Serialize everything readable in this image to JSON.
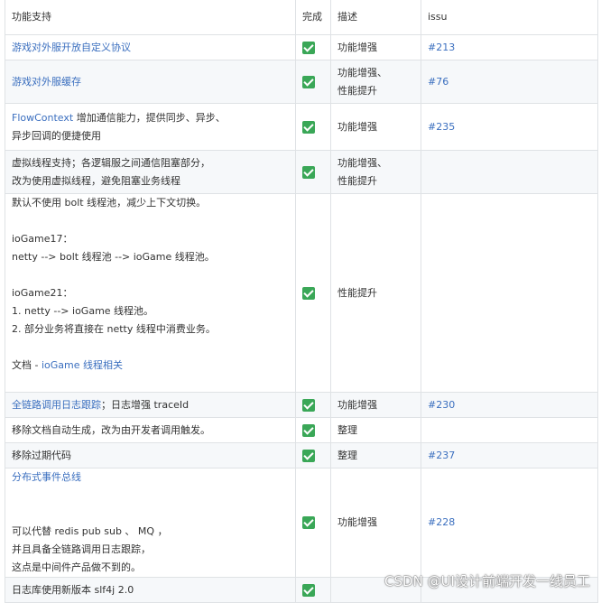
{
  "headers": [
    "功能支持",
    "完成",
    "描述",
    "issu"
  ],
  "rows": [
    {
      "feature": [
        {
          "segments": [
            {
              "t": "游戏对外服开放自定义协议",
              "link": true
            }
          ]
        }
      ],
      "done": true,
      "desc": [
        "功能增强"
      ],
      "issue": "#213"
    },
    {
      "feature": [
        {
          "segments": [
            {
              "t": "游戏对外服缓存",
              "link": true
            }
          ]
        }
      ],
      "done": true,
      "desc": [
        "功能增强、",
        "性能提升"
      ],
      "issue": "#76"
    },
    {
      "feature": [
        {
          "segments": [
            {
              "t": "FlowContext",
              "link": true
            },
            {
              "t": " 增加通信能力，提供同步、异步、",
              "link": false
            }
          ]
        },
        {
          "segments": [
            {
              "t": "异步回调的便捷使用",
              "link": false
            }
          ]
        }
      ],
      "done": true,
      "desc": [
        "功能增强"
      ],
      "issue": "#235"
    },
    {
      "feature": [
        {
          "segments": [
            {
              "t": "虚拟线程支持；各逻辑服之间通信阻塞部分，",
              "link": false
            }
          ]
        },
        {
          "segments": [
            {
              "t": "改为使用虚拟线程，避免阻塞业务线程",
              "link": false
            }
          ]
        }
      ],
      "done": true,
      "desc": [
        "功能增强、",
        "性能提升"
      ],
      "issue": ""
    },
    {
      "feature": [
        {
          "segments": [
            {
              "t": "默认不使用 bolt 线程池，减少上下文切换。",
              "link": false
            }
          ]
        },
        {
          "segments": []
        },
        {
          "segments": [
            {
              "t": "ioGame17：",
              "link": false
            }
          ]
        },
        {
          "segments": [
            {
              "t": "netty --> bolt 线程池 --> ioGame 线程池。",
              "link": false
            }
          ]
        },
        {
          "segments": []
        },
        {
          "segments": [
            {
              "t": "ioGame21：",
              "link": false
            }
          ]
        },
        {
          "segments": [
            {
              "t": "1. netty --> ioGame 线程池。",
              "link": false
            }
          ]
        },
        {
          "segments": [
            {
              "t": "2. 部分业务将直接在 netty 线程中消费业务。",
              "link": false
            }
          ]
        },
        {
          "segments": []
        },
        {
          "segments": [
            {
              "t": "文档 - ",
              "link": false
            },
            {
              "t": "ioGame 线程相关",
              "link": true
            }
          ]
        }
      ],
      "done": true,
      "desc": [
        "性能提升"
      ],
      "issue": ""
    },
    {
      "feature": [
        {
          "segments": [
            {
              "t": "全链路调用日志跟踪",
              "link": true
            },
            {
              "t": "；日志增强 traceId",
              "link": false
            }
          ]
        }
      ],
      "done": true,
      "desc": [
        "功能增强"
      ],
      "issue": "#230"
    },
    {
      "feature": [
        {
          "segments": [
            {
              "t": "移除文档自动生成，改为由开发者调用触发。",
              "link": false
            }
          ]
        }
      ],
      "done": true,
      "desc": [
        "整理"
      ],
      "issue": ""
    },
    {
      "feature": [
        {
          "segments": [
            {
              "t": "移除过期代码",
              "link": false
            }
          ]
        }
      ],
      "done": true,
      "desc": [
        "整理"
      ],
      "issue": "#237"
    },
    {
      "feature": [
        {
          "segments": [
            {
              "t": "分布式事件总线",
              "link": true
            }
          ]
        },
        {
          "segments": []
        },
        {
          "segments": []
        },
        {
          "segments": [
            {
              "t": "可以代替 redis pub sub 、 MQ ，",
              "link": false
            }
          ]
        },
        {
          "segments": [
            {
              "t": "并且具备全链路调用日志跟踪，",
              "link": false
            }
          ]
        },
        {
          "segments": [
            {
              "t": "这点是中间件产品做不到的。",
              "link": false
            }
          ]
        }
      ],
      "done": true,
      "desc": [
        "功能增强"
      ],
      "issue": "#228"
    },
    {
      "feature": [
        {
          "segments": [
            {
              "t": "日志库使用新版本 slf4j 2.0",
              "link": false
            }
          ]
        }
      ],
      "done": true,
      "desc": [],
      "issue": ""
    }
  ],
  "watermark": "CSDN @UI设计前端开发一线员工",
  "colors": {
    "link": "#3b6fbf",
    "check": "#3aa757",
    "stripe": "#f6f8fa",
    "border": "#dfe2e5"
  }
}
